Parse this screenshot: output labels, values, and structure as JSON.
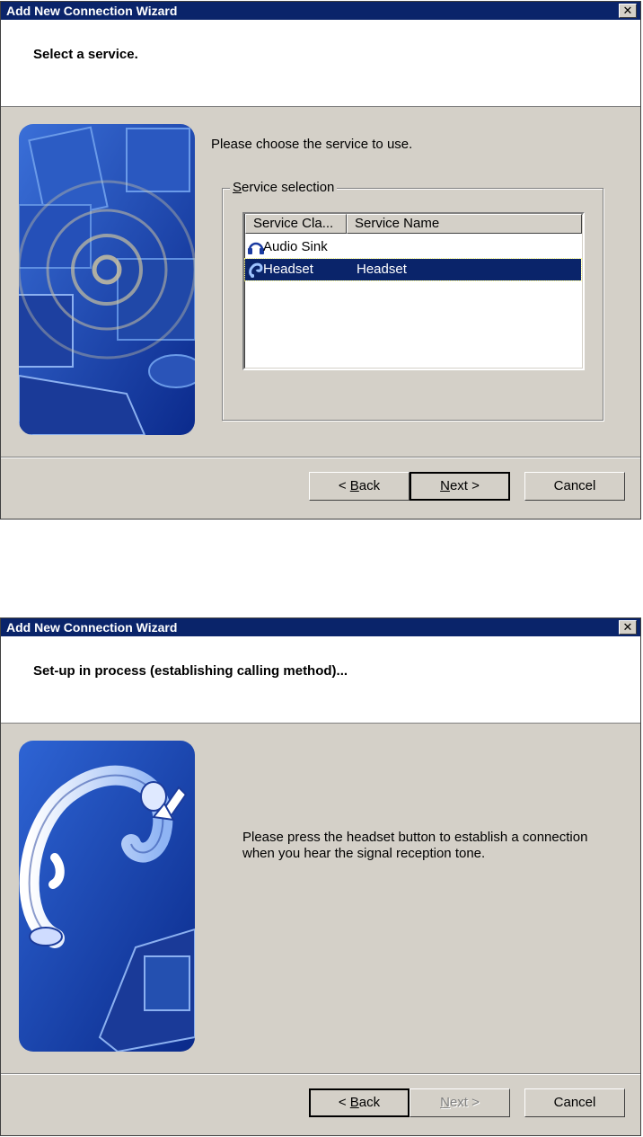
{
  "dialog1": {
    "title": "Add New Connection Wizard",
    "close_icon": "close-icon",
    "header_title": "Select a service.",
    "instruction": "Please choose the service to use.",
    "group": {
      "label_mnemonic": "S",
      "label_rest": "ervice selection"
    },
    "columns": [
      "Service Cla...",
      "Service Name"
    ],
    "rows": [
      {
        "icon": "headphones-icon",
        "class": "Audio Sink",
        "name": ""
      },
      {
        "icon": "headset-icon",
        "class": "Headset",
        "name": "Headset",
        "selected": true
      }
    ],
    "buttons": {
      "back_prefix": "< ",
      "back_mnemonic": "B",
      "back_rest": "ack",
      "next_mnemonic": "N",
      "next_rest": "ext >",
      "cancel": "Cancel"
    }
  },
  "dialog2": {
    "title": "Add New Connection Wizard",
    "close_icon": "close-icon",
    "header_title": "Set-up in process (establishing calling method)...",
    "instruction_line1": "Please press the headset button to establish a connection",
    "instruction_line2": "when you hear the signal reception tone.",
    "buttons": {
      "back_prefix": "< ",
      "back_mnemonic": "B",
      "back_rest": "ack",
      "next_mnemonic": "N",
      "next_rest": "ext >",
      "cancel": "Cancel",
      "next_disabled": true
    }
  }
}
